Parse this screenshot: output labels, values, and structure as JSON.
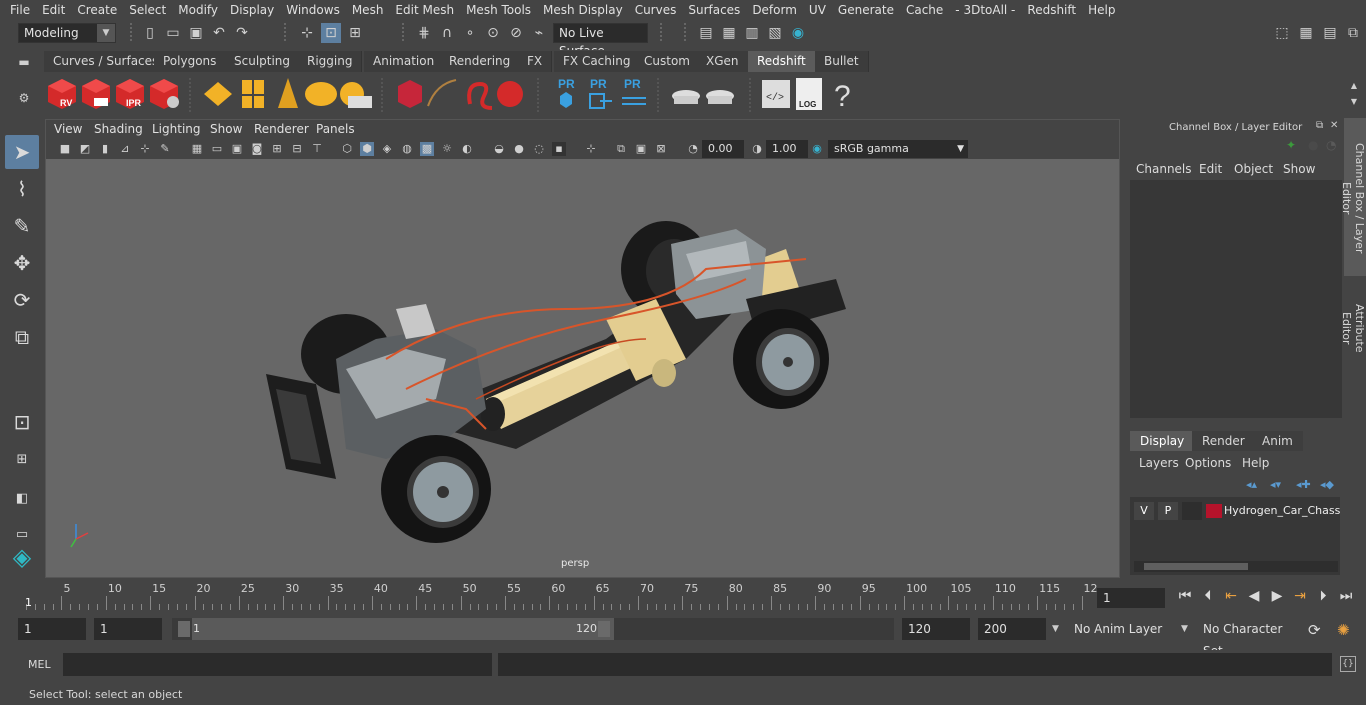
{
  "menubar": [
    "File",
    "Edit",
    "Create",
    "Select",
    "Modify",
    "Display",
    "Windows",
    "Mesh",
    "Edit Mesh",
    "Mesh Tools",
    "Mesh Display",
    "Curves",
    "Surfaces",
    "Deform",
    "UV",
    "Generate",
    "Cache",
    "- 3DtoAll -",
    "Redshift",
    "Help"
  ],
  "status": {
    "mode_label": "Modeling",
    "live_surface_label": "No Live Surface"
  },
  "shelf_tabs": [
    "Curves / Surfaces",
    "Polygons",
    "Sculpting",
    "Rigging",
    "Animation",
    "Rendering",
    "FX",
    "FX Caching",
    "Custom",
    "XGen",
    "Redshift",
    "Bullet"
  ],
  "shelf_active_tab": "Redshift",
  "shelf_icon_labels": {
    "rv": "RV",
    "ipr": "IPR",
    "pr1": "PR",
    "pr2": "PR",
    "pr3": "PR",
    "log": "LOG",
    "help": "?"
  },
  "viewport": {
    "menu": [
      "View",
      "Shading",
      "Lighting",
      "Show",
      "Renderer",
      "Panels"
    ],
    "exposure": "0.00",
    "gamma": "1.00",
    "color_space": "sRGB gamma",
    "camera_label": "persp"
  },
  "channel_box": {
    "title": "Channel Box / Layer Editor",
    "menu": [
      "Channels",
      "Edit",
      "Object",
      "Show"
    ]
  },
  "side_tabs": [
    "Channel Box / Layer Editor",
    "Attribute Editor"
  ],
  "layer_editor": {
    "tabs": [
      "Display",
      "Render",
      "Anim"
    ],
    "active_tab": "Display",
    "menu": [
      "Layers",
      "Options",
      "Help"
    ],
    "layers": [
      {
        "visible": "V",
        "playback": "P",
        "color": "#b5132b",
        "name": "Hydrogen_Car_Chassis"
      }
    ]
  },
  "timeline": {
    "ticks": [
      "5",
      "10",
      "15",
      "20",
      "25",
      "30",
      "35",
      "40",
      "45",
      "50",
      "55",
      "60",
      "65",
      "70",
      "75",
      "80",
      "85",
      "90",
      "95",
      "100",
      "105",
      "110",
      "115",
      "12"
    ],
    "current_frame_marker": "1",
    "current_frame_field": "1"
  },
  "range": {
    "start_field": "1",
    "playback_start": "1",
    "slider_start": "1",
    "slider_end": "120",
    "playback_end": "120",
    "end_field": "200",
    "anim_layer": "No Anim Layer",
    "character_set": "No Character Set"
  },
  "mel": {
    "label": "MEL"
  },
  "help_line": "Select Tool: select an object",
  "colors": {
    "accent": "#5d7fa0",
    "redshift_red": "#d42a2a",
    "maya_teal": "#2fb9c4"
  }
}
